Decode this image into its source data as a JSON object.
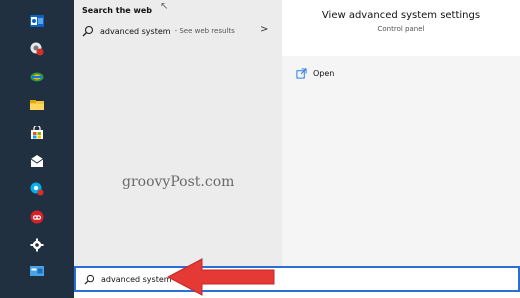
{
  "taskbar": {
    "icons": [
      {
        "name": "outlook-icon"
      },
      {
        "name": "chrome-canary-badge-icon"
      },
      {
        "name": "pinned-app-icon"
      },
      {
        "name": "file-explorer-icon"
      },
      {
        "name": "store-icon"
      },
      {
        "name": "mail-icon"
      },
      {
        "name": "skype-badge-icon"
      },
      {
        "name": "creative-cloud-icon"
      },
      {
        "name": "settings-icon"
      },
      {
        "name": "window-app-icon"
      }
    ]
  },
  "results": {
    "section_title": "Search the web",
    "web_result": {
      "query": "advanced system",
      "suffix": "- See web results",
      "chevron": ">"
    },
    "watermark": "groovyPost.com"
  },
  "detail": {
    "title": "View advanced system settings",
    "subtitle": "Control panel",
    "open_label": "Open"
  },
  "search": {
    "value": "advanced system"
  },
  "colors": {
    "taskbar_bg": "#203041",
    "accent_blue": "#2a6fd6",
    "arrow_red": "#e53935"
  }
}
